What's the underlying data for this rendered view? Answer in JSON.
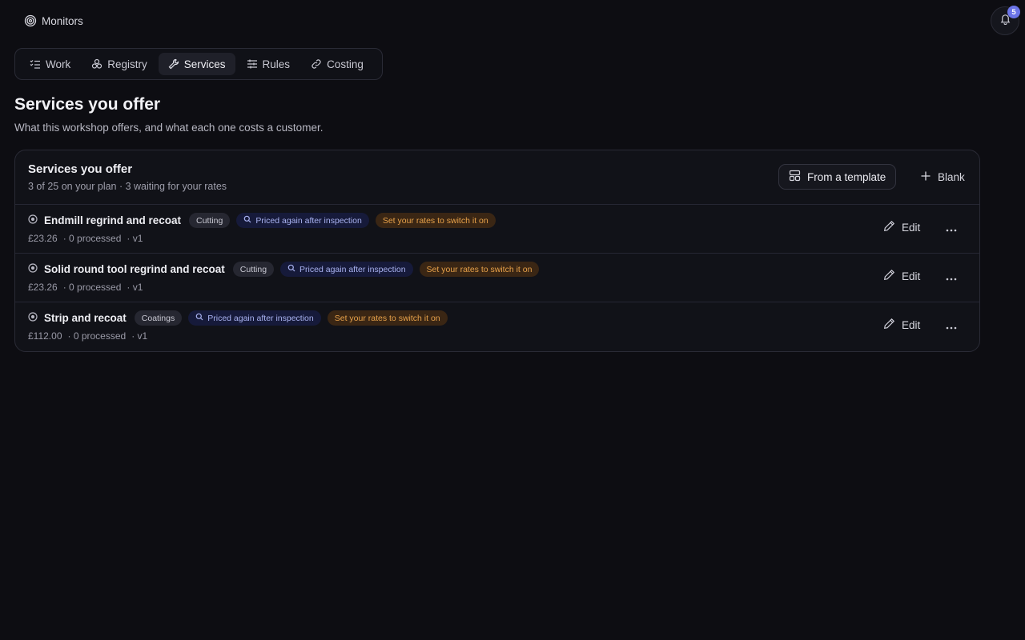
{
  "app": {
    "title": "Monitors"
  },
  "notifications": {
    "count": "5"
  },
  "tabs": [
    {
      "label": "Work",
      "icon": "checklist-icon",
      "active": false
    },
    {
      "label": "Registry",
      "icon": "cubes-icon",
      "active": false
    },
    {
      "label": "Services",
      "icon": "wrench-icon",
      "active": true
    },
    {
      "label": "Rules",
      "icon": "sliders-icon",
      "active": false
    },
    {
      "label": "Costing",
      "icon": "link-icon",
      "active": false
    }
  ],
  "page": {
    "title": "Services you offer",
    "subtitle": "What this workshop offers, and what each one costs a customer."
  },
  "card": {
    "title": "Services you offer",
    "subtitle": "3 of 25 on your plan · 3 waiting for your rates",
    "template_button": "From a template",
    "blank_button": "Blank"
  },
  "services": [
    {
      "name": "Endmill regrind and recoat",
      "category": "Cutting",
      "inspection": "Priced again after inspection",
      "warning": "Set your rates to switch it on",
      "price": "£23.26",
      "processed": "· 0 processed",
      "version": "· v1",
      "edit_label": "Edit"
    },
    {
      "name": "Solid round tool regrind and recoat",
      "category": "Cutting",
      "inspection": "Priced again after inspection",
      "warning": "Set your rates to switch it on",
      "price": "£23.26",
      "processed": "· 0 processed",
      "version": "· v1",
      "edit_label": "Edit"
    },
    {
      "name": "Strip and recoat",
      "category": "Coatings",
      "inspection": "Priced again after inspection",
      "warning": "Set your rates to switch it on",
      "price": "£112.00",
      "processed": "· 0 processed",
      "version": "· v1",
      "edit_label": "Edit"
    }
  ],
  "colors": {
    "background": "#0d0d12",
    "accent": "#6b74e8",
    "warning": "#e8a24a",
    "inspection": "#a9b2f0"
  }
}
